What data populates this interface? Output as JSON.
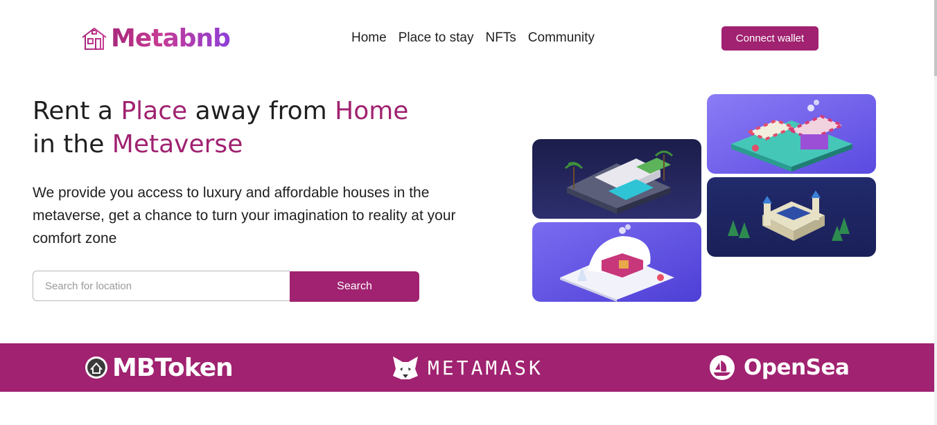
{
  "header": {
    "logo_text": "Metabnb",
    "nav": [
      "Home",
      "Place to stay",
      "NFTs",
      "Community"
    ],
    "connect_label": "Connect wallet"
  },
  "hero": {
    "title_parts": [
      "Rent a ",
      "Place",
      " away from ",
      "Home",
      " in the ",
      "Metaverse"
    ],
    "description": "We provide you access to luxury and affordable houses in the metaverse, get a chance to turn your imagination to reality at your comfort zone",
    "search_placeholder": "Search for location",
    "search_label": "Search"
  },
  "nft_cards": [
    {
      "icon": "modern-villa-illustration"
    },
    {
      "icon": "snow-cottage-illustration"
    },
    {
      "icon": "market-stall-illustration"
    },
    {
      "icon": "castle-fort-illustration"
    }
  ],
  "partners": {
    "mbtoken": "MBToken",
    "metamask": "METAMASK",
    "opensea": "OpenSea"
  },
  "colors": {
    "brand": "#a02270",
    "brand_gradient_end": "#8e3fd7"
  }
}
